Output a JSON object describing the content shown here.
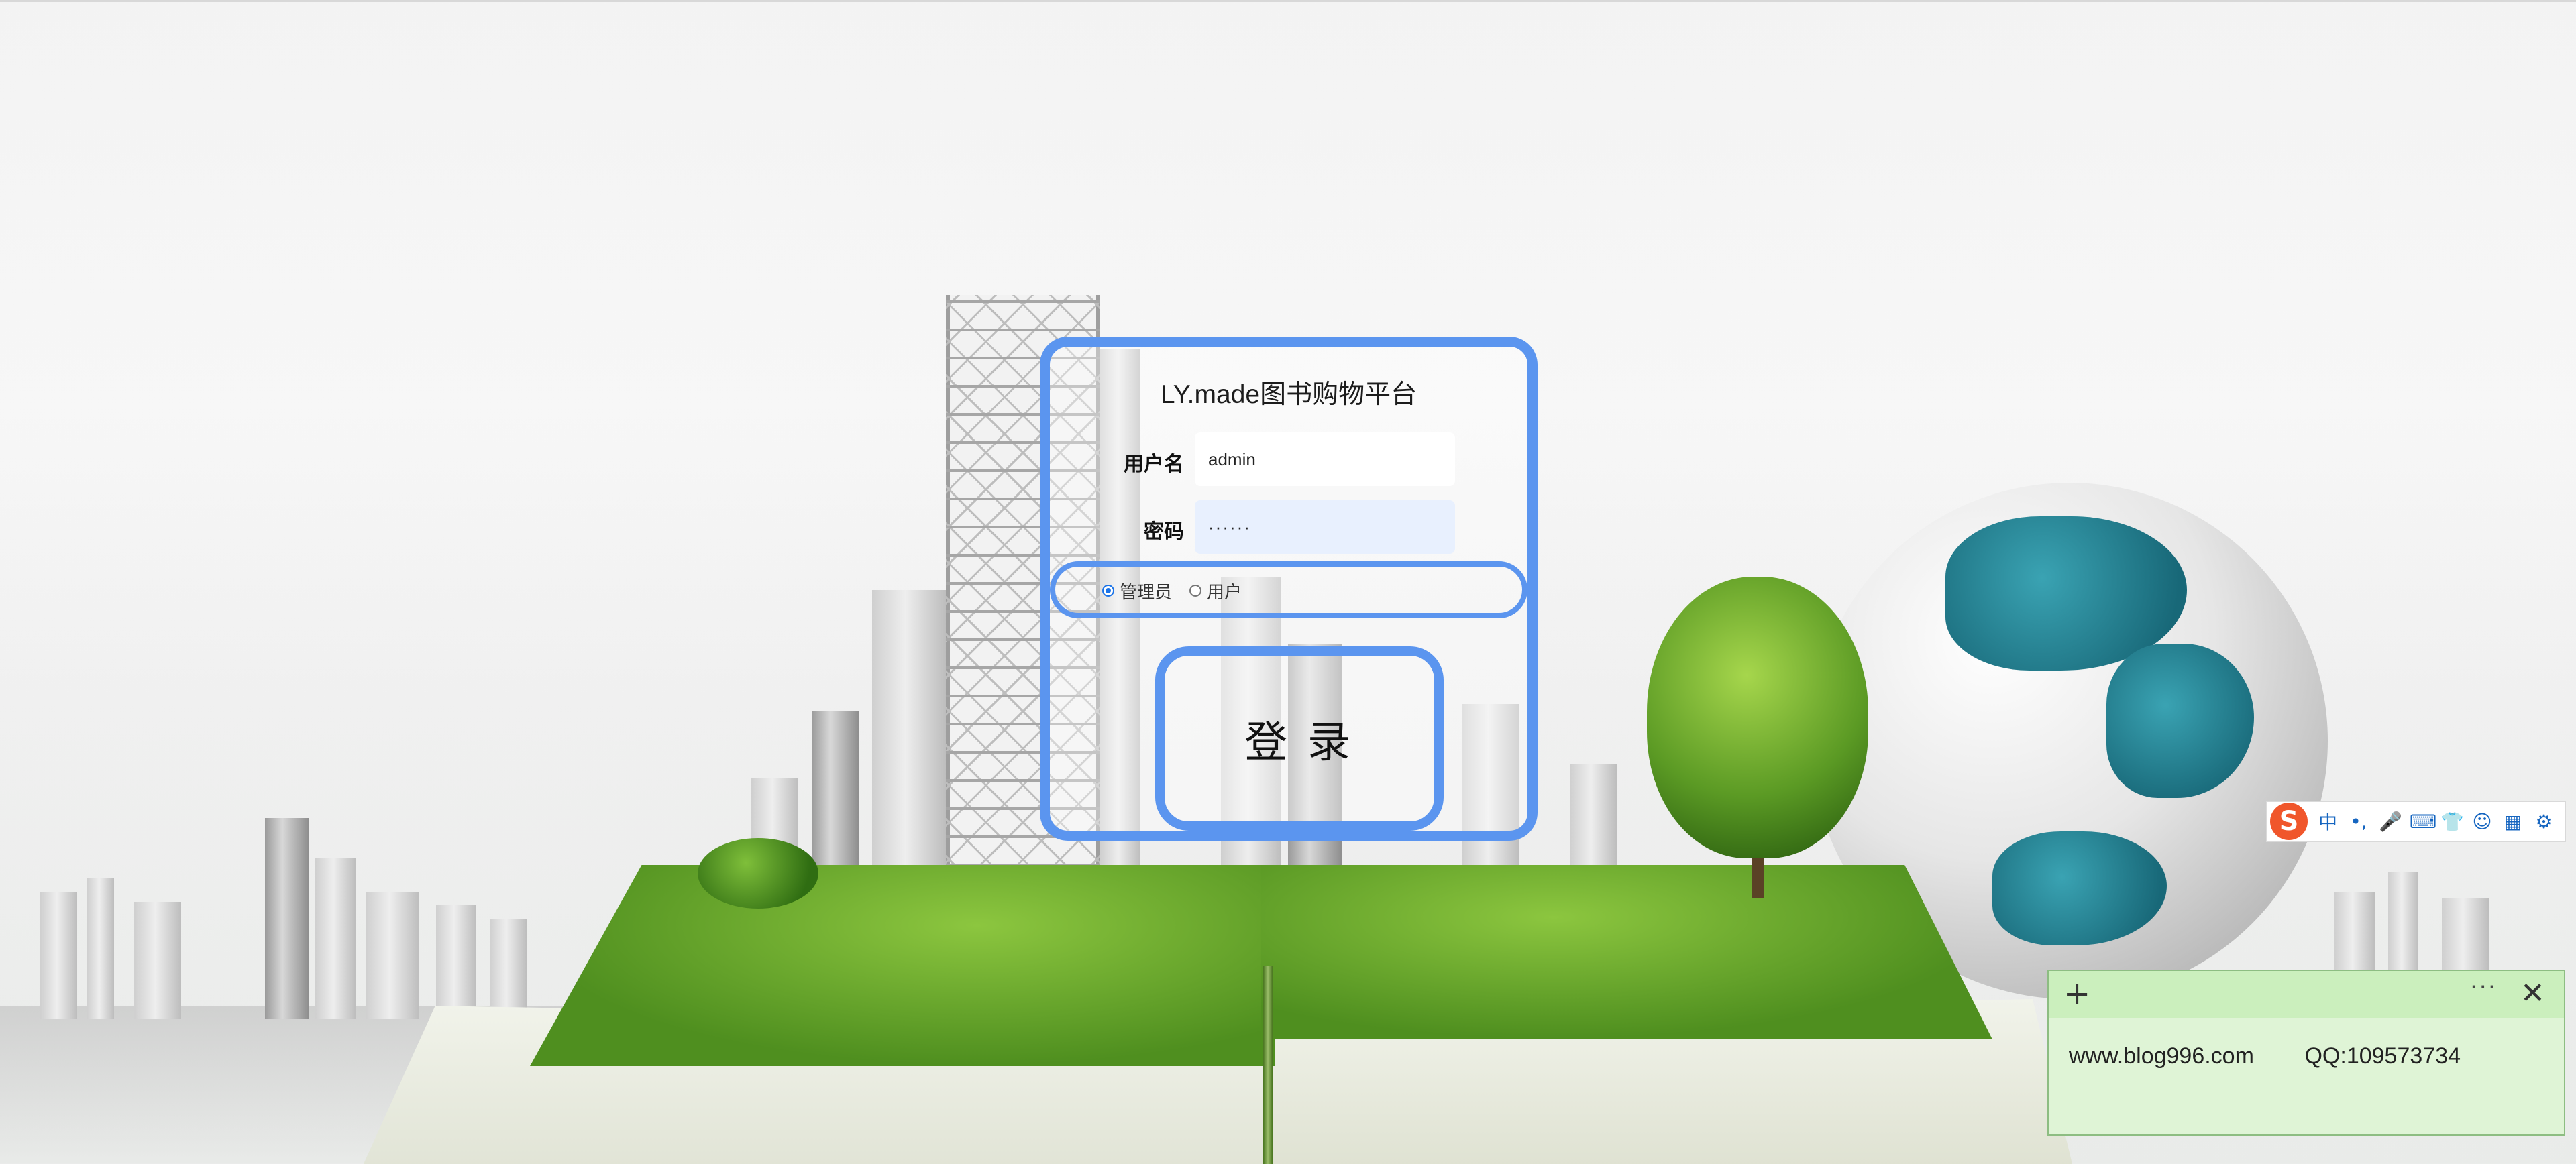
{
  "login": {
    "title": "LY.made图书购物平台",
    "username_label": "用户名",
    "username_value": "admin",
    "password_label": "密码",
    "password_value": "······",
    "roles": [
      {
        "label": "管理员",
        "checked": true
      },
      {
        "label": "用户",
        "checked": false
      }
    ],
    "submit_label": "登 录"
  },
  "ime_toolbar": {
    "logo": "S",
    "items": [
      {
        "icon": "chinese-mode-icon",
        "glyph": "中"
      },
      {
        "icon": "punctuation-icon",
        "glyph": "•,"
      },
      {
        "icon": "microphone-icon",
        "glyph": "🎤"
      },
      {
        "icon": "keyboard-icon",
        "glyph": "⌨"
      },
      {
        "icon": "skin-icon",
        "glyph": "👕"
      },
      {
        "icon": "bot-icon",
        "glyph": "☺"
      },
      {
        "icon": "apps-grid-icon",
        "glyph": "▦"
      },
      {
        "icon": "settings-icon",
        "glyph": "⚙"
      }
    ]
  },
  "sticky_note": {
    "add_glyph": "+",
    "more_glyph": "···",
    "close_glyph": "✕",
    "text": "www.blog996.com        QQ:109573734"
  },
  "colors": {
    "accent": "#5b95ef",
    "note_bg": "#dff4d6",
    "ime_logo": "#f0562b"
  }
}
